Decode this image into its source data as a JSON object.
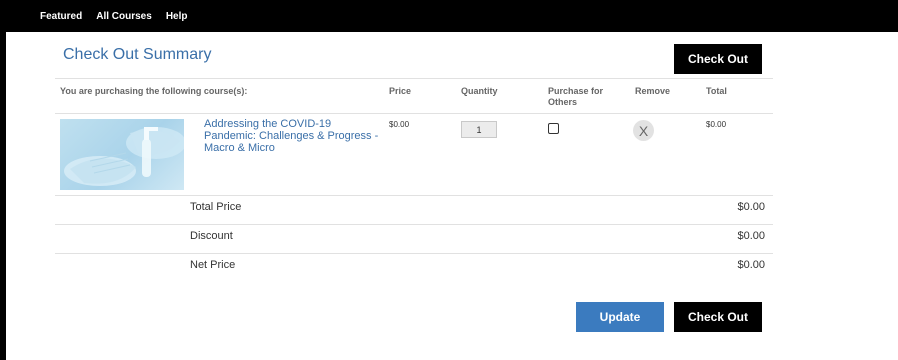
{
  "nav": {
    "items": [
      "Featured",
      "All Courses",
      "Help"
    ]
  },
  "page": {
    "title": "Check Out Summary",
    "checkout_label": "Check Out",
    "update_label": "Update"
  },
  "table": {
    "headers": {
      "course": "You are purchasing the following course(s):",
      "price": "Price",
      "quantity": "Quantity",
      "purchase_for_others": "Purchase for Others",
      "remove": "Remove",
      "total": "Total"
    },
    "rows": [
      {
        "title": "Addressing the COVID-19 Pandemic: Challenges & Progress - Macro & Micro",
        "price": "$0.00",
        "quantity": "1",
        "purchase_for_others": false,
        "remove_label": "X",
        "total": "$0.00"
      }
    ]
  },
  "summary": {
    "rows": [
      {
        "label": "Total Price",
        "value": "$0.00"
      },
      {
        "label": "Discount",
        "value": "$0.00"
      },
      {
        "label": "Net Price",
        "value": "$0.00"
      }
    ]
  },
  "colors": {
    "accent": "#3a6fa8",
    "update_button": "#3b7bbf",
    "checkout_button": "#000000"
  }
}
